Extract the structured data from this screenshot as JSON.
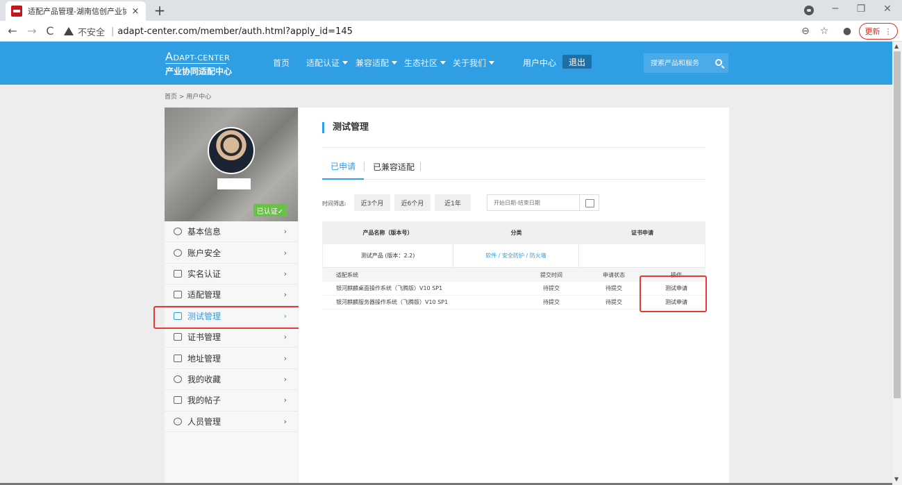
{
  "browser": {
    "tab_title": "适配产品管理-湖南信创产业协同",
    "tab_close": "×",
    "new_tab": "+",
    "address_warning": "不安全",
    "address_separator": "|",
    "url": "adapt-center.com/member/auth.html?apply_id=145",
    "update_label": "更新",
    "update_menu": "⋮",
    "back": "←",
    "forward": "→",
    "reload": "C",
    "zoom_icon": "⊖",
    "bookmark_icon": "☆",
    "account_icon": "●",
    "win_minimize": "─",
    "win_restore": "❐",
    "win_close": "✕"
  },
  "site": {
    "logo_letter": "A",
    "logo_top": "DAPT-CENTER",
    "logo_bottom": "产业协同适配中心",
    "nav": [
      {
        "label": "首页",
        "dropdown": false
      },
      {
        "label": "适配认证",
        "dropdown": true
      },
      {
        "label": "兼容适配",
        "dropdown": true
      },
      {
        "label": "生态社区",
        "dropdown": true
      },
      {
        "label": "关于我们",
        "dropdown": true
      }
    ],
    "user_center": "用户中心",
    "logout": "退出",
    "search_placeholder": "搜索产品和服务",
    "accent_color": "#2f9ee2"
  },
  "breadcrumb": "首页 > 用户中心",
  "profile": {
    "verified_label": "已认证✓"
  },
  "sidebar": {
    "items": [
      {
        "label": "基本信息",
        "icon": "user-icon",
        "active": false
      },
      {
        "label": "账户安全",
        "icon": "shield-icon",
        "active": false
      },
      {
        "label": "实名认证",
        "icon": "id-card-icon",
        "active": false
      },
      {
        "label": "适配管理",
        "icon": "adapt-icon",
        "active": false
      },
      {
        "label": "测试管理",
        "icon": "document-icon",
        "active": true
      },
      {
        "label": "证书管理",
        "icon": "certificate-icon",
        "active": false
      },
      {
        "label": "地址管理",
        "icon": "address-icon",
        "active": false
      },
      {
        "label": "我的收藏",
        "icon": "star-icon",
        "active": false
      },
      {
        "label": "我的帖子",
        "icon": "post-icon",
        "active": false
      },
      {
        "label": "人员管理",
        "icon": "people-icon",
        "active": false
      }
    ],
    "arrow": "›"
  },
  "main": {
    "title": "测试管理",
    "tabs": [
      {
        "label": "已申请",
        "active": true
      },
      {
        "label": "已兼容适配",
        "active": false
      }
    ],
    "filter_label": "时间筛选:",
    "filter_buttons": [
      "近3个月",
      "近6个月",
      "近1年"
    ],
    "date_placeholder": "开始日期-结束日期",
    "table": {
      "headers": [
        "产品名称（版本号）",
        "分类",
        "证书申请"
      ],
      "product": {
        "name": "测试产品 (版本：2.2)",
        "category": "软件 / 安全防护 / 防火墙",
        "certificate": ""
      },
      "sub_headers": {
        "system": "适配系统",
        "submit_time": "提交时间",
        "status": "申请状态",
        "operation": "操作"
      },
      "rows": [
        {
          "system": "银河麒麟桌面操作系统（飞腾版）V10 SP1",
          "submit_time": "待提交",
          "status": "待提交",
          "operation": "测试申请"
        },
        {
          "system": "银河麒麟服务器操作系统（飞腾版）V10 SP1",
          "submit_time": "待提交",
          "status": "待提交",
          "operation": "测试申请"
        }
      ]
    }
  }
}
